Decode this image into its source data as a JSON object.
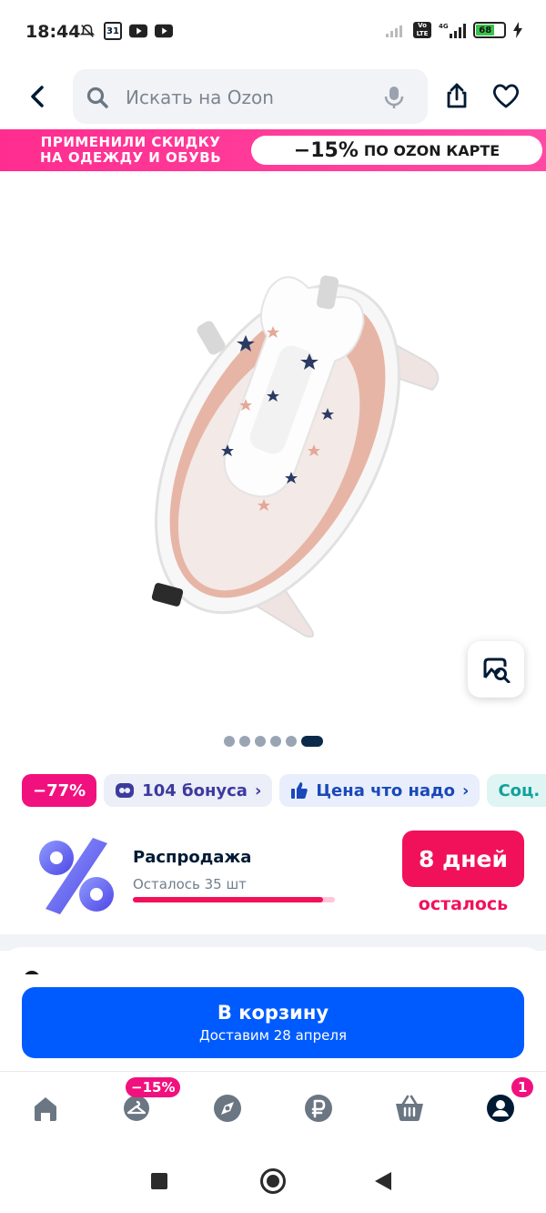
{
  "status_bar": {
    "time": "18:44",
    "calendar_day": "31",
    "battery_level": "68"
  },
  "header": {
    "search_placeholder": "Искать на Ozon"
  },
  "promo_banner": {
    "left_text_line1": "ПРИМЕНИЛИ СКИДКУ",
    "left_text_line2": "НА ОДЕЖДУ И ОБУВЬ",
    "discount": "−15%",
    "discount_text": "ПО OZON КАРТЕ",
    "background_color": "#ff2d8f"
  },
  "gallery": {
    "image_count": 6,
    "active_index": 5
  },
  "badges": [
    {
      "label": "−77%",
      "type": "discount"
    },
    {
      "label": "104 бонуса",
      "type": "bonus"
    },
    {
      "label": "Цена что надо",
      "type": "price"
    },
    {
      "label": "Соц. се",
      "type": "social"
    }
  ],
  "sale": {
    "title": "Распродажа",
    "remaining": "Осталось 35 шт",
    "progress": 0.94,
    "days_left": "8 дней",
    "days_label": "осталось"
  },
  "cart_button": {
    "label": "В корзину",
    "delivery": "Доставим 28 апреля",
    "color": "#005bff"
  },
  "bottom_nav": {
    "fashion_badge": "−15%",
    "profile_badge": "1"
  },
  "colors": {
    "accent_pink": "#f1115a",
    "brand_blue": "#005bff"
  }
}
